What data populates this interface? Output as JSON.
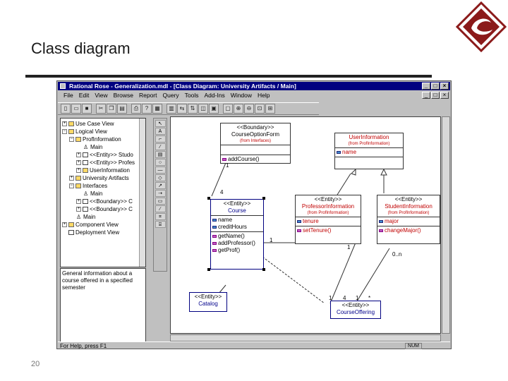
{
  "slide": {
    "title": "Class diagram",
    "page_number": "20"
  },
  "window": {
    "title": "Rational Rose - Generalization.mdl - [Class Diagram: University Artifacts / Main]",
    "menu": [
      "File",
      "Edit",
      "View",
      "Browse",
      "Report",
      "Query",
      "Tools",
      "Add-Ins",
      "Window",
      "Help"
    ],
    "toolbar_icons": [
      "new-icon",
      "open-icon",
      "save-icon",
      "cut-icon",
      "copy-icon",
      "paste-icon",
      "print-icon",
      "help-icon",
      "browse-icon",
      "class-diagram-icon",
      "interaction-icon",
      "sequence-icon",
      "state-icon",
      "component-icon",
      "deployment-icon",
      "zoom-in-icon",
      "zoom-out-icon",
      "fit-icon",
      "layout-icon"
    ],
    "status": "For Help, press F1",
    "num_indicator": "NUM"
  },
  "browser": {
    "items": [
      {
        "label": "Use Case View",
        "kind": "folder"
      },
      {
        "label": "Logical View",
        "kind": "folder"
      },
      {
        "label": "ProfInformation",
        "kind": "folder"
      },
      {
        "label": "Main",
        "kind": "diagram"
      },
      {
        "label": "<<Entity>> Studo",
        "kind": "class"
      },
      {
        "label": "<<Entity>> Profes",
        "kind": "class"
      },
      {
        "label": "UserInformation",
        "kind": "folder"
      },
      {
        "label": "University Artifacts",
        "kind": "folder"
      },
      {
        "label": "Interfaces",
        "kind": "folder"
      },
      {
        "label": "Main",
        "kind": "diagram"
      },
      {
        "label": "<<Boundary>> C",
        "kind": "class"
      },
      {
        "label": "<<Boundary>> C",
        "kind": "class"
      },
      {
        "label": "Main",
        "kind": "diagram"
      },
      {
        "label": "Component View",
        "kind": "folder"
      },
      {
        "label": "Deployment View",
        "kind": "folder"
      }
    ],
    "documentation": "General information about a course offered in a specified semester"
  },
  "palette": [
    "select-tool",
    "text-tool",
    "note-tool",
    "anchor-tool",
    "class-tool",
    "interface-tool",
    "association-tool",
    "aggregation-tool",
    "generalization-tool",
    "dependency-tool",
    "package-tool",
    "realize-tool",
    "parameterized-tool",
    "instantiated-tool"
  ],
  "diagram": {
    "course_option_form": {
      "stereotype": "<<Boundary>>",
      "name": "CourseOptionForm",
      "from": "(from Interfaces)",
      "ops": [
        "addCourse()"
      ]
    },
    "user_information": {
      "name": "UserInformation",
      "from": "(from ProfInformation)",
      "attrs": [
        "name"
      ]
    },
    "course": {
      "stereotype": "<<Entity>>",
      "name": "Course",
      "attrs": [
        "name",
        "creditHours"
      ],
      "ops": [
        "getName()",
        "addProfessor()",
        "getProf()"
      ]
    },
    "professor_information": {
      "stereotype": "<<Entity>>",
      "name": "ProfessorInformation",
      "from": "(from ProfInformation)",
      "attrs": [
        "tenure"
      ],
      "ops": [
        "setTenure()"
      ]
    },
    "student_information": {
      "stereotype": "<<Entity>>",
      "name": "StudentInformation",
      "from": "(from ProfInformation)",
      "attrs": [
        "major"
      ],
      "ops": [
        "changeMajor()"
      ]
    },
    "catalog": {
      "stereotype": "<<Entity>>",
      "name": "Catalog"
    },
    "course_offering": {
      "stereotype": "<<Entity>>",
      "name": "CourseOffering"
    },
    "multiplicities": {
      "form_course_1": "1",
      "form_course_4": "4",
      "prof_1": "1",
      "student_0n": "0..n",
      "off_1a": "1",
      "off_4": "4",
      "off_1b": "1",
      "off_star": "*",
      "course_1": "1"
    }
  }
}
